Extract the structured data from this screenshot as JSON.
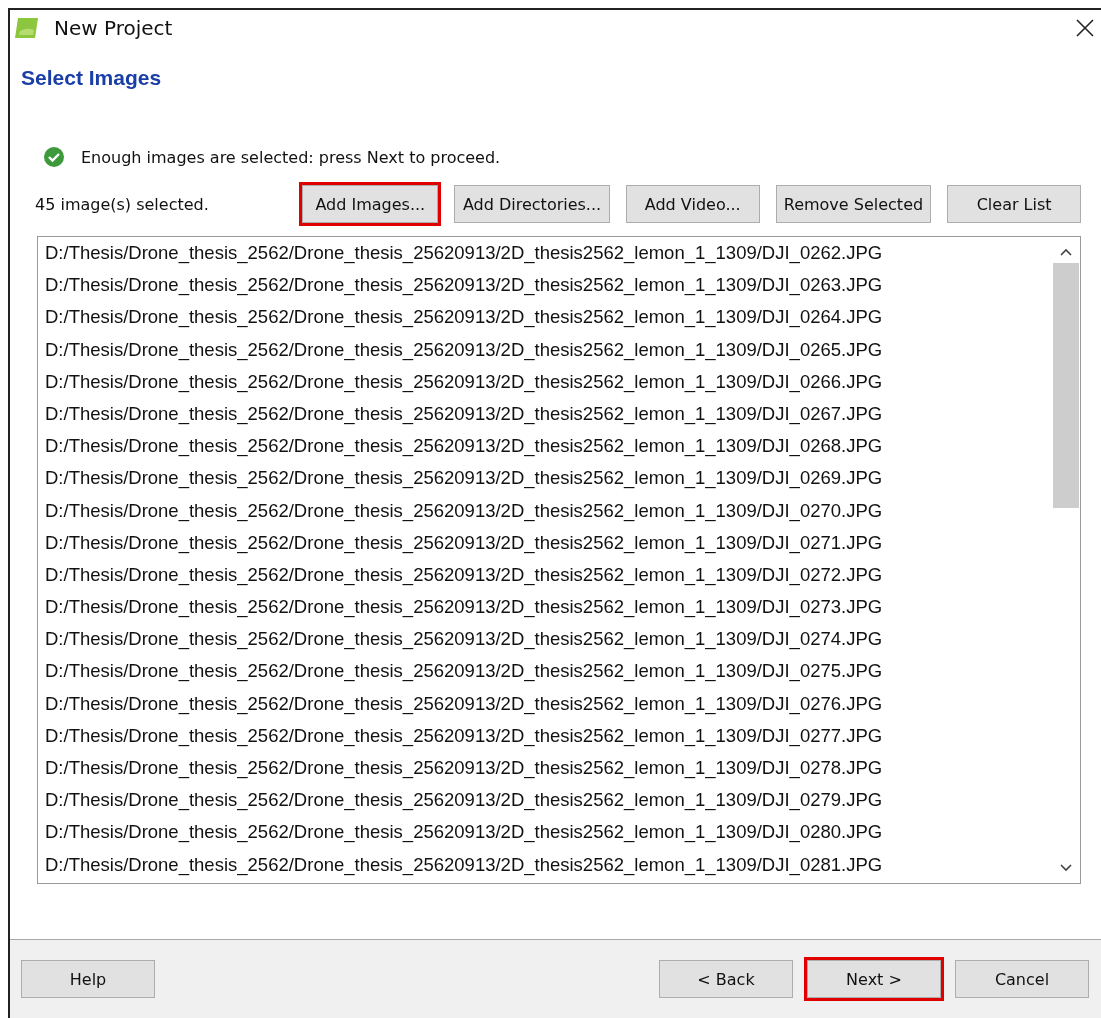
{
  "window": {
    "title": "New Project"
  },
  "heading": "Select Images",
  "status": {
    "kind": "ok",
    "message": "Enough images are selected: press Next to proceed."
  },
  "selection_count": "45 image(s) selected.",
  "toolbar_buttons": [
    {
      "label": "Add Images...",
      "highlighted": true
    },
    {
      "label": "Add Directories...",
      "highlighted": false
    },
    {
      "label": "Add Video...",
      "highlighted": false
    },
    {
      "label": "Remove Selected",
      "highlighted": false
    },
    {
      "label": "Clear List",
      "highlighted": false
    }
  ],
  "files": [
    "D:/Thesis/Drone_thesis_2562/Drone_thesis_25620913/2D_thesis2562_lemon_1_1309/DJI_0262.JPG",
    "D:/Thesis/Drone_thesis_2562/Drone_thesis_25620913/2D_thesis2562_lemon_1_1309/DJI_0263.JPG",
    "D:/Thesis/Drone_thesis_2562/Drone_thesis_25620913/2D_thesis2562_lemon_1_1309/DJI_0264.JPG",
    "D:/Thesis/Drone_thesis_2562/Drone_thesis_25620913/2D_thesis2562_lemon_1_1309/DJI_0265.JPG",
    "D:/Thesis/Drone_thesis_2562/Drone_thesis_25620913/2D_thesis2562_lemon_1_1309/DJI_0266.JPG",
    "D:/Thesis/Drone_thesis_2562/Drone_thesis_25620913/2D_thesis2562_lemon_1_1309/DJI_0267.JPG",
    "D:/Thesis/Drone_thesis_2562/Drone_thesis_25620913/2D_thesis2562_lemon_1_1309/DJI_0268.JPG",
    "D:/Thesis/Drone_thesis_2562/Drone_thesis_25620913/2D_thesis2562_lemon_1_1309/DJI_0269.JPG",
    "D:/Thesis/Drone_thesis_2562/Drone_thesis_25620913/2D_thesis2562_lemon_1_1309/DJI_0270.JPG",
    "D:/Thesis/Drone_thesis_2562/Drone_thesis_25620913/2D_thesis2562_lemon_1_1309/DJI_0271.JPG",
    "D:/Thesis/Drone_thesis_2562/Drone_thesis_25620913/2D_thesis2562_lemon_1_1309/DJI_0272.JPG",
    "D:/Thesis/Drone_thesis_2562/Drone_thesis_25620913/2D_thesis2562_lemon_1_1309/DJI_0273.JPG",
    "D:/Thesis/Drone_thesis_2562/Drone_thesis_25620913/2D_thesis2562_lemon_1_1309/DJI_0274.JPG",
    "D:/Thesis/Drone_thesis_2562/Drone_thesis_25620913/2D_thesis2562_lemon_1_1309/DJI_0275.JPG",
    "D:/Thesis/Drone_thesis_2562/Drone_thesis_25620913/2D_thesis2562_lemon_1_1309/DJI_0276.JPG",
    "D:/Thesis/Drone_thesis_2562/Drone_thesis_25620913/2D_thesis2562_lemon_1_1309/DJI_0277.JPG",
    "D:/Thesis/Drone_thesis_2562/Drone_thesis_25620913/2D_thesis2562_lemon_1_1309/DJI_0278.JPG",
    "D:/Thesis/Drone_thesis_2562/Drone_thesis_25620913/2D_thesis2562_lemon_1_1309/DJI_0279.JPG",
    "D:/Thesis/Drone_thesis_2562/Drone_thesis_25620913/2D_thesis2562_lemon_1_1309/DJI_0280.JPG",
    "D:/Thesis/Drone_thesis_2562/Drone_thesis_25620913/2D_thesis2562_lemon_1_1309/DJI_0281.JPG"
  ],
  "footer_buttons": [
    {
      "label": "Help",
      "highlighted": false
    },
    {
      "label": "< Back",
      "highlighted": false
    },
    {
      "label": "Next >",
      "highlighted": true
    },
    {
      "label": "Cancel",
      "highlighted": false
    }
  ]
}
